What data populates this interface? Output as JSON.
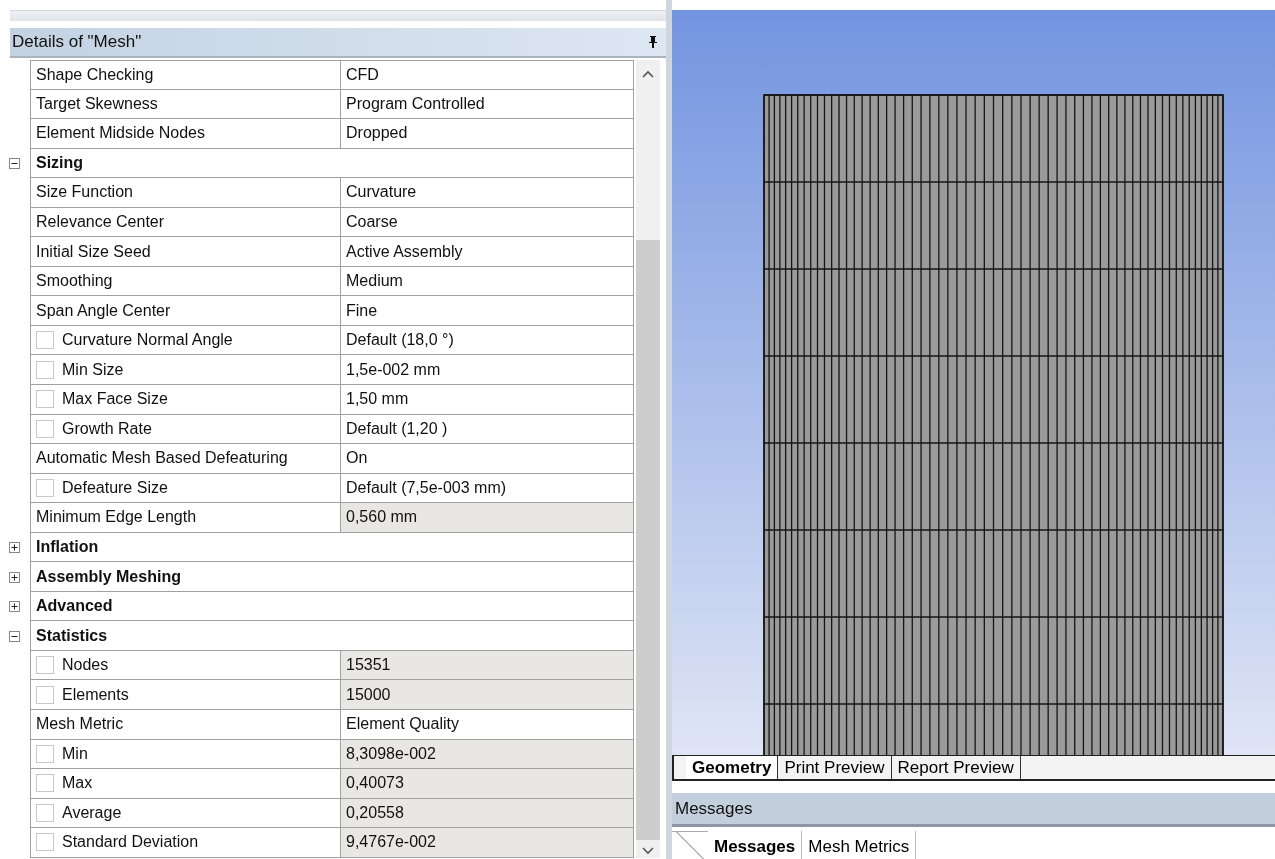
{
  "details": {
    "title": "Details of \"Mesh\"",
    "rows": [
      {
        "kind": "property",
        "label": "Shape Checking",
        "value": "CFD",
        "readonly": false
      },
      {
        "kind": "property",
        "label": "Target Skewness",
        "value": "Program Controlled",
        "readonly": false
      },
      {
        "kind": "property",
        "label": "Element Midside Nodes",
        "value": "Dropped",
        "readonly": false
      },
      {
        "kind": "group",
        "label": "Sizing",
        "expanded": true
      },
      {
        "kind": "property",
        "label": "Size Function",
        "value": "Curvature",
        "readonly": false
      },
      {
        "kind": "property",
        "label": "Relevance Center",
        "value": "Coarse",
        "readonly": false
      },
      {
        "kind": "property",
        "label": "Initial Size Seed",
        "value": "Active Assembly",
        "readonly": false
      },
      {
        "kind": "property",
        "label": "Smoothing",
        "value": "Medium",
        "readonly": false
      },
      {
        "kind": "property",
        "label": "Span Angle Center",
        "value": "Fine",
        "readonly": false
      },
      {
        "kind": "parameter",
        "label": "Curvature Normal Angle",
        "value": "Default (18,0 °)",
        "checked": false,
        "readonly": false
      },
      {
        "kind": "parameter",
        "label": "Min Size",
        "value": "1,5e-002 mm",
        "checked": false,
        "readonly": false
      },
      {
        "kind": "parameter",
        "label": "Max Face Size",
        "value": "1,50 mm",
        "checked": false,
        "readonly": false
      },
      {
        "kind": "parameter",
        "label": "Growth Rate",
        "value": "Default (1,20 )",
        "checked": false,
        "readonly": false
      },
      {
        "kind": "property",
        "label": "Automatic Mesh Based Defeaturing",
        "value": "On",
        "readonly": false
      },
      {
        "kind": "parameter",
        "label": "Defeature Size",
        "value": "Default (7,5e-003 mm)",
        "checked": false,
        "readonly": false
      },
      {
        "kind": "property",
        "label": "Minimum Edge Length",
        "value": "0,560 mm",
        "readonly": true
      },
      {
        "kind": "group",
        "label": "Inflation",
        "expanded": false
      },
      {
        "kind": "group",
        "label": "Assembly Meshing",
        "expanded": false
      },
      {
        "kind": "group",
        "label": "Advanced",
        "expanded": false
      },
      {
        "kind": "group",
        "label": "Statistics",
        "expanded": true
      },
      {
        "kind": "parameter",
        "label": "Nodes",
        "value": "15351",
        "checked": false,
        "readonly": true
      },
      {
        "kind": "parameter",
        "label": "Elements",
        "value": "15000",
        "checked": false,
        "readonly": true
      },
      {
        "kind": "property",
        "label": "Mesh Metric",
        "value": "Element Quality",
        "readonly": false
      },
      {
        "kind": "parameter",
        "label": "Min",
        "value": "8,3098e-002",
        "checked": false,
        "readonly": true
      },
      {
        "kind": "parameter",
        "label": "Max",
        "value": "0,40073",
        "checked": false,
        "readonly": true
      },
      {
        "kind": "parameter",
        "label": "Average",
        "value": "0,20558",
        "checked": false,
        "readonly": true
      },
      {
        "kind": "parameter",
        "label": "Standard Deviation",
        "value": "9,4767e-002",
        "checked": false,
        "readonly": true
      }
    ]
  },
  "view_tabs": [
    {
      "label": "Geometry",
      "selected": true
    },
    {
      "label": "Print Preview",
      "selected": false
    },
    {
      "label": "Report Preview",
      "selected": false
    }
  ],
  "messages": {
    "title": "Messages",
    "tabs": [
      {
        "label": "Messages",
        "selected": true
      },
      {
        "label": "Mesh Metrics",
        "selected": false
      }
    ]
  }
}
